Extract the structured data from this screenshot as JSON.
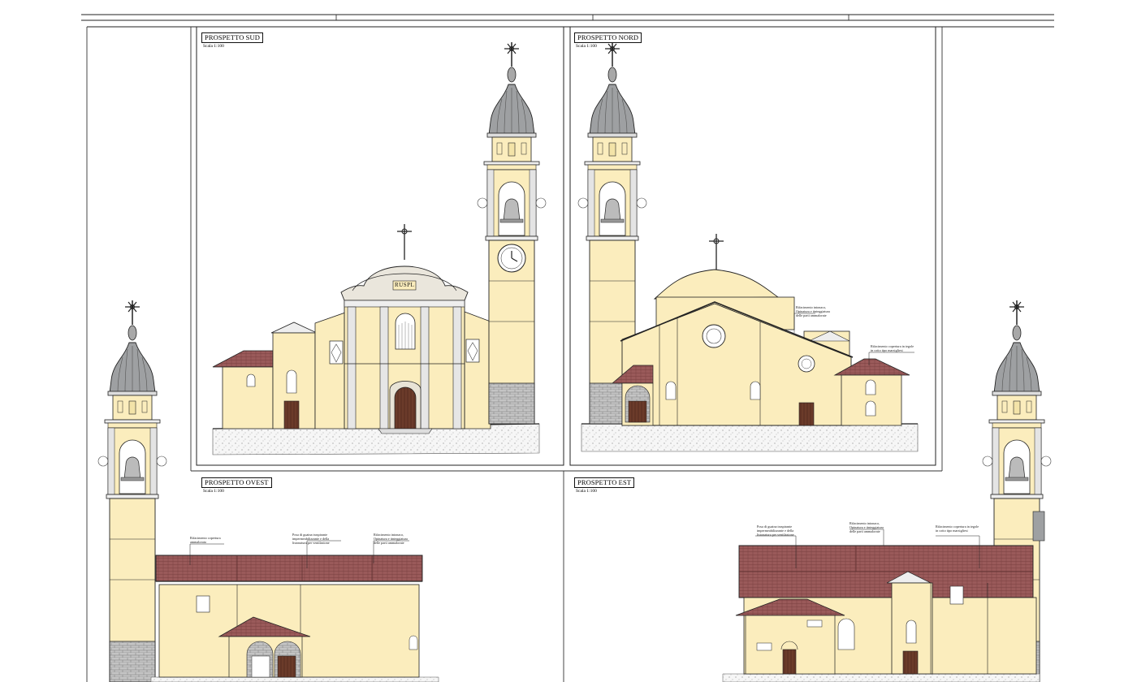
{
  "sheet": {
    "panels": [
      {
        "id": "sud",
        "title": "PROSPETTO SUD",
        "scale": "Scala 1:100"
      },
      {
        "id": "nord",
        "title": "PROSPETTO NORD",
        "scale": "Scala 1:100"
      },
      {
        "id": "ovest",
        "title": "PROSPETTO OVEST",
        "scale": "Scala 1:100"
      },
      {
        "id": "est",
        "title": "PROSPETTO EST",
        "scale": "Scala 1:100"
      }
    ],
    "facade_inscription": "RUSPL",
    "notes": {
      "nord_1": "Rifacimento intonaco, Opinatura e tinteggiatura delle parti ammalorate",
      "nord_2": "Rifacimento copertura in tegole in cotto tipo marsigliesi",
      "ovest_1": "Rifacimento copertura ammalorata",
      "ovest_2": "Posa di guaina traspirante impermeabilizzante e della listonatura per ventilazione",
      "ovest_3": "Rifacimento intonaco, Opinatura e tinteggiatura delle parti ammalorate",
      "est_1": "Posa di guaina traspirante impermeabilizzante e della listonatura per ventilazione",
      "est_2": "Rifacimento intonaco, Opinatura e tinteggiatura delle parti ammalorate",
      "est_3": "Rifacimento copertura in tegole in cotto tipo marsigliesi"
    },
    "colors": {
      "wall": "#fbedbd",
      "roof": "#9a5a5a",
      "stone": "#b9b9b9",
      "dome": "#9ea0a2",
      "line": "#222222"
    }
  }
}
